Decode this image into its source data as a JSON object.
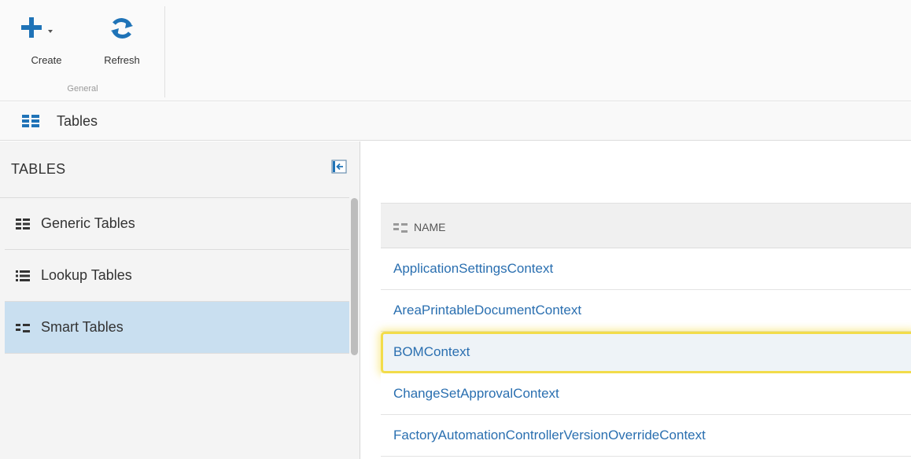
{
  "ribbon": {
    "group_label": "General",
    "create": {
      "label": "Create",
      "icon": "plus-icon"
    },
    "refresh": {
      "label": "Refresh",
      "icon": "refresh-icon"
    }
  },
  "title_bar": {
    "title": "Tables",
    "icon": "tables-grid-icon"
  },
  "sidebar": {
    "title": "TABLES",
    "collapse_icon": "collapse-left-icon",
    "items": [
      {
        "label": "Generic Tables",
        "icon": "generic-tables-icon",
        "active": false
      },
      {
        "label": "Lookup Tables",
        "icon": "lookup-tables-icon",
        "active": false
      },
      {
        "label": "Smart Tables",
        "icon": "smart-tables-icon",
        "active": true
      }
    ]
  },
  "grid": {
    "column_header": "NAME",
    "header_icon": "smart-tables-icon",
    "rows": [
      {
        "name": "ApplicationSettingsContext"
      },
      {
        "name": "AreaPrintableDocumentContext"
      },
      {
        "name": "BOMContext",
        "selected": true
      },
      {
        "name": "ChangeSetApprovalContext"
      },
      {
        "name": "FactoryAutomationControllerVersionOverrideContext"
      }
    ]
  },
  "colors": {
    "accent": "#1f73b7",
    "link": "#2a6fb0",
    "active_item_bg": "#c9dff0",
    "selection_outline": "#f2dc4a"
  }
}
